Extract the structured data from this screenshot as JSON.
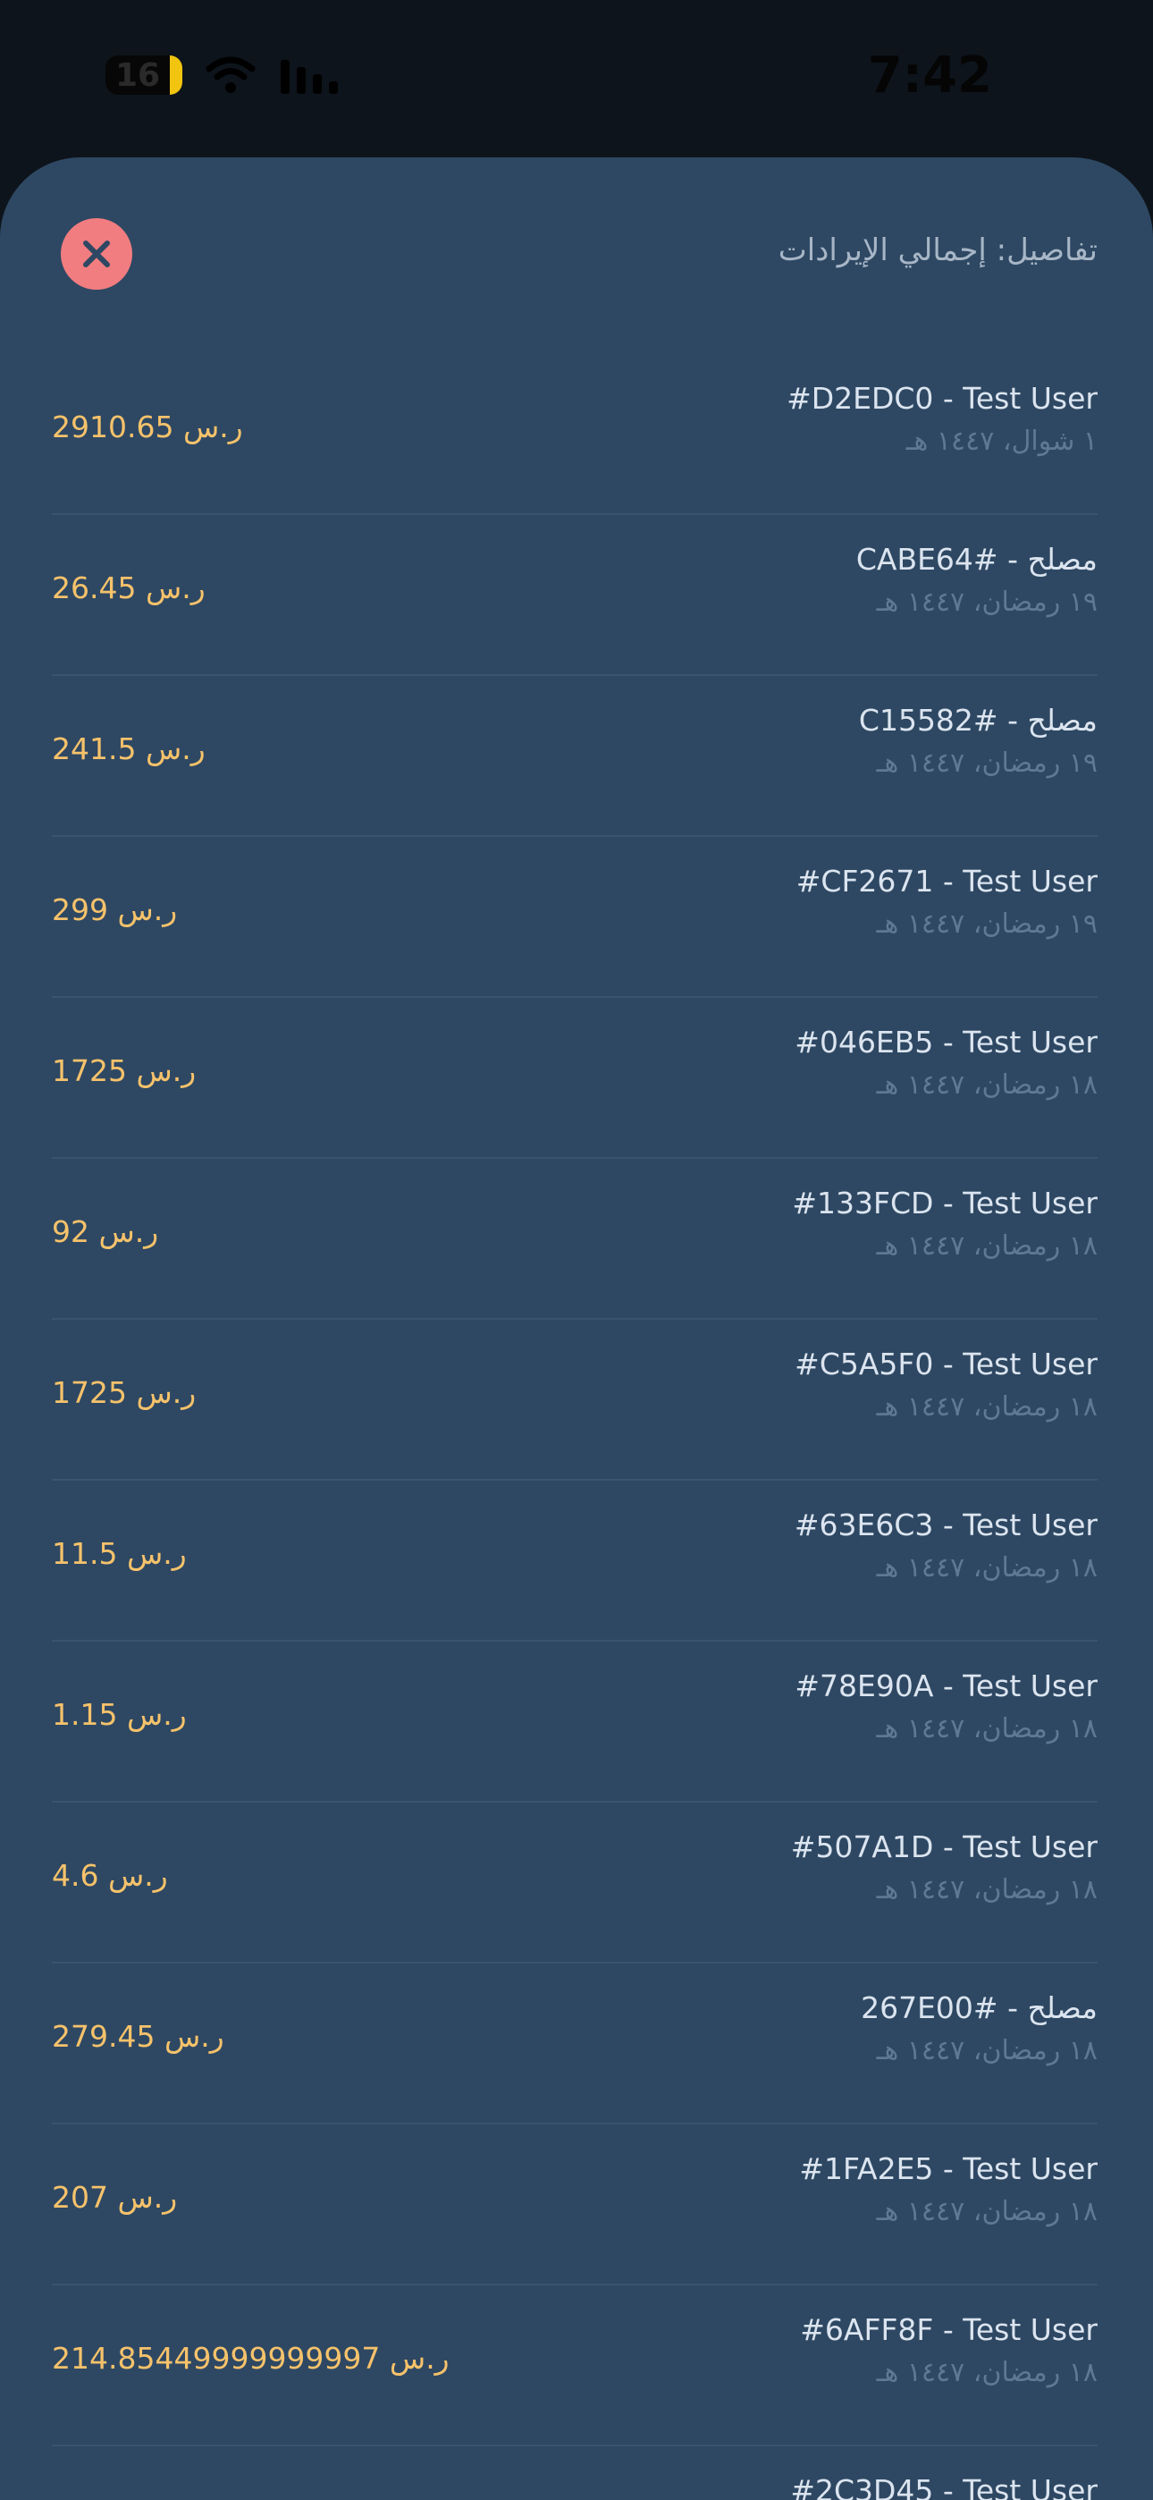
{
  "status_bar": {
    "battery": "16",
    "time": "7:42",
    "colors": {
      "battery_fill": "#f1c40f"
    }
  },
  "sheet": {
    "title": "تفاصيل: إجمالي الإيرادات",
    "close_icon": "close-icon",
    "colors": {
      "background": "#2e4863",
      "close_button": "#f27d80",
      "amount": "#f6c26b"
    }
  },
  "rows": [
    {
      "title": "#D2EDC0 - Test User",
      "date": "١ شوال، ١٤٤٧ هـ",
      "amount": "2910.65 ر.س"
    },
    {
      "title": "مصلح - CABE64#",
      "date": "١٩ رمضان، ١٤٤٧ هـ",
      "amount": "26.45 ر.س"
    },
    {
      "title": "مصلح - C15582#",
      "date": "١٩ رمضان، ١٤٤٧ هـ",
      "amount": "241.5 ر.س"
    },
    {
      "title": "#CF2671 - Test User",
      "date": "١٩ رمضان، ١٤٤٧ هـ",
      "amount": "299 ر.س"
    },
    {
      "title": "#046EB5 - Test User",
      "date": "١٨ رمضان، ١٤٤٧ هـ",
      "amount": "1725 ر.س"
    },
    {
      "title": "#133FCD - Test User",
      "date": "١٨ رمضان، ١٤٤٧ هـ",
      "amount": "92 ر.س"
    },
    {
      "title": "#C5A5F0 - Test User",
      "date": "١٨ رمضان، ١٤٤٧ هـ",
      "amount": "1725 ر.س"
    },
    {
      "title": "#63E6C3 - Test User",
      "date": "١٨ رمضان، ١٤٤٧ هـ",
      "amount": "11.5 ر.س"
    },
    {
      "title": "#78E90A - Test User",
      "date": "١٨ رمضان، ١٤٤٧ هـ",
      "amount": "1.15 ر.س"
    },
    {
      "title": "#507A1D - Test User",
      "date": "١٨ رمضان، ١٤٤٧ هـ",
      "amount": "4.6 ر.س"
    },
    {
      "title": "مصلح - 267E00#",
      "date": "١٨ رمضان، ١٤٤٧ هـ",
      "amount": "279.45 ر.س"
    },
    {
      "title": "#1FA2E5 - Test User",
      "date": "١٨ رمضان، ١٤٤٧ هـ",
      "amount": "207 ر.س"
    },
    {
      "title": "#6AFF8F - Test User",
      "date": "١٨ رمضان، ١٤٤٧ هـ",
      "amount": "214.85449999999997 ر.س"
    },
    {
      "title": "#2C3D45 - Test User",
      "date": "",
      "amount": ""
    }
  ]
}
